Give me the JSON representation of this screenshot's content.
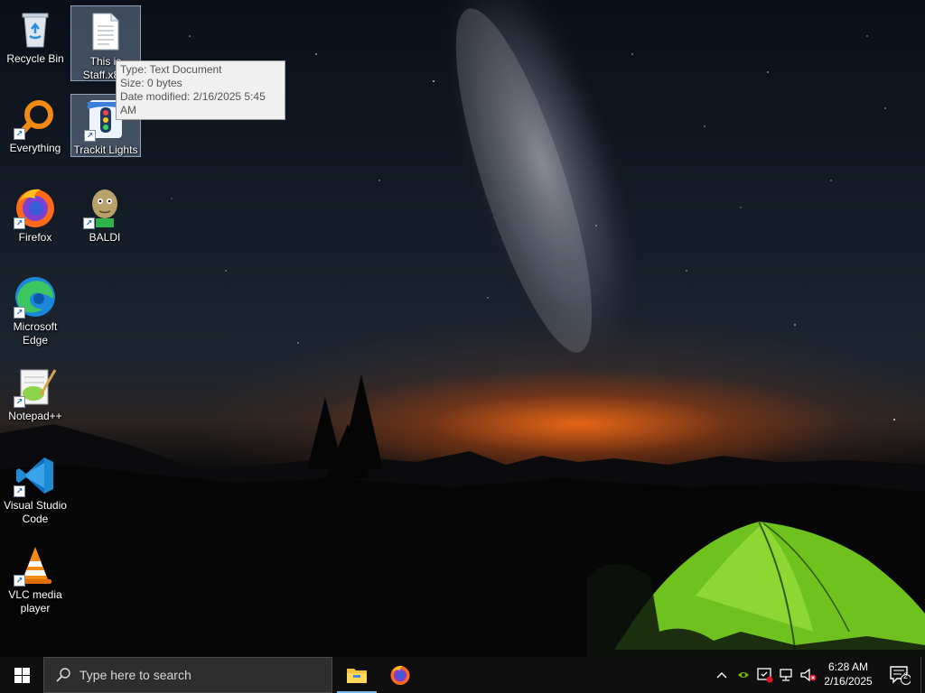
{
  "desktop": {
    "icons": [
      {
        "label": "Recycle Bin"
      },
      {
        "label": "Everything"
      },
      {
        "label": "Firefox"
      },
      {
        "label": "Microsoft Edge"
      },
      {
        "label": "Notepad++"
      },
      {
        "label": "Visual Studio Code"
      },
      {
        "label": "VLC media player"
      },
      {
        "label": "This is Staff.x8..."
      },
      {
        "label": "Trackit Lights"
      },
      {
        "label": "BALDI"
      }
    ]
  },
  "tooltip": {
    "type": "Type: Text Document",
    "size": "Size: 0 bytes",
    "modified": "Date modified: 2/16/2025 5:45 AM"
  },
  "taskbar": {
    "search_placeholder": "Type here to search",
    "apps": [
      {
        "name": "File Explorer",
        "icon": "folder-icon",
        "active": true
      },
      {
        "name": "Firefox",
        "icon": "firefox-icon",
        "active": false
      }
    ],
    "tray": {
      "icons": [
        "chevron-up-icon",
        "nvidia-icon",
        "defender-icon",
        "network-icon",
        "volume-muted-icon"
      ],
      "time": "6:28 AM",
      "date": "2/16/2025",
      "notification_count": "2"
    }
  },
  "colors": {
    "taskbar_bg": "#0f0f0f",
    "accent": "#76b9ed",
    "tent_green": "#7ed321"
  }
}
